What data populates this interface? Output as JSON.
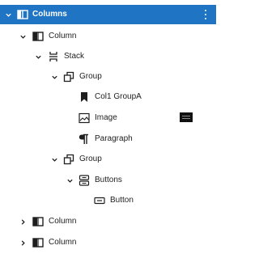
{
  "tree": {
    "root": {
      "label": "Columns",
      "icon": "columns-icon",
      "expanded": true
    },
    "nodes": [
      {
        "label": "Column",
        "icon": "column-icon",
        "expanded": true
      },
      {
        "label": "Stack",
        "icon": "stack-icon",
        "expanded": true
      },
      {
        "label": "Group",
        "icon": "group-icon",
        "expanded": true
      },
      {
        "label": "Col1 GroupA",
        "icon": "bookmark-icon"
      },
      {
        "label": "Image",
        "icon": "image-icon"
      },
      {
        "label": "Paragraph",
        "icon": "paragraph-icon"
      },
      {
        "label": "Group",
        "icon": "group-icon",
        "expanded": true
      },
      {
        "label": "Buttons",
        "icon": "buttons-icon",
        "expanded": true
      },
      {
        "label": "Button",
        "icon": "button-icon"
      },
      {
        "label": "Column",
        "icon": "column-icon",
        "expanded": false
      },
      {
        "label": "Column",
        "icon": "column-icon",
        "expanded": false
      }
    ]
  },
  "colors": {
    "selected_bg": "#1f74c4",
    "text": "#1e1e1e"
  }
}
